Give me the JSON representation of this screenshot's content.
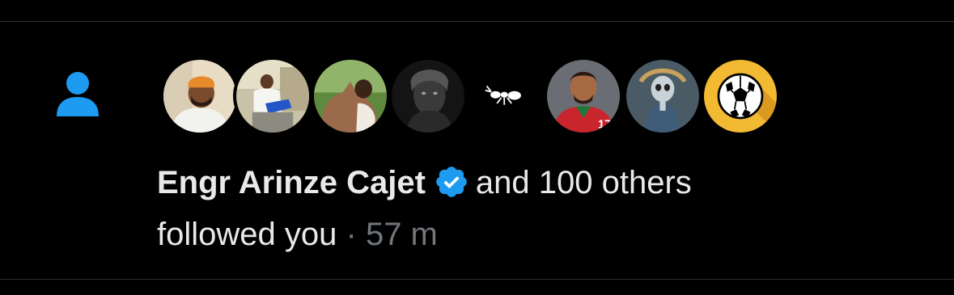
{
  "notification": {
    "type_icon": "person-icon",
    "accent_color": "#1d9bf0",
    "actor_name": "Engr Arinze Cajet",
    "verified_icon": "verified-badge-icon",
    "others_text": "and 100 others",
    "action_text": "followed you",
    "separator": "·",
    "timestamp": "57 m"
  },
  "avatars": [
    {
      "icon": "avatar-man-orange-cap"
    },
    {
      "icon": "avatar-man-seated-white"
    },
    {
      "icon": "avatar-woman-outdoors"
    },
    {
      "icon": "avatar-dark-portrait"
    },
    {
      "icon": "ant-icon"
    },
    {
      "icon": "avatar-footballer-red-jersey"
    },
    {
      "icon": "avatar-skeleton-figure"
    },
    {
      "icon": "soccer-ball-icon"
    }
  ]
}
